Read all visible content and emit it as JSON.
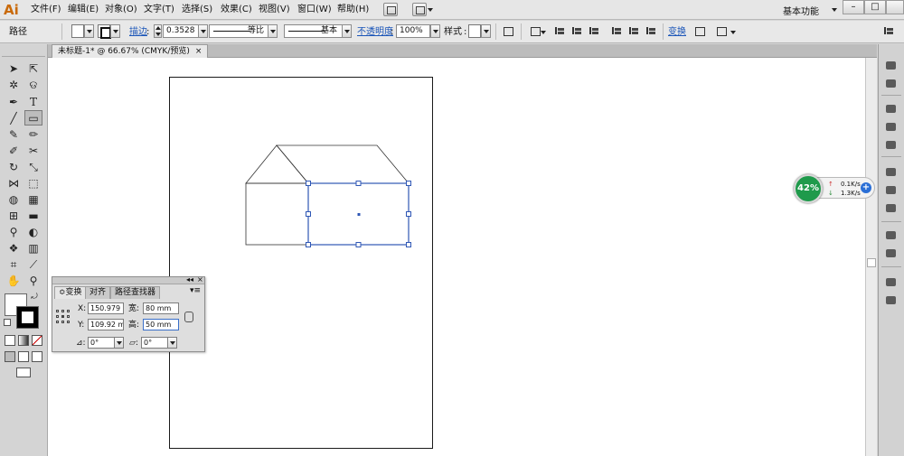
{
  "app": {
    "logo": "Ai"
  },
  "menu": {
    "items": [
      "文件(F)",
      "编辑(E)",
      "对象(O)",
      "文字(T)",
      "选择(S)",
      "效果(C)",
      "视图(V)",
      "窗口(W)",
      "帮助(H)"
    ],
    "workspace": "基本功能",
    "window_buttons": [
      "–",
      "□",
      "×"
    ]
  },
  "control_bar": {
    "object_type": "路径",
    "stroke_label": "描边",
    "stroke_weight": "0.3528",
    "profile": "等比",
    "brush": "基本",
    "opacity_label": "不透明度",
    "opacity": "100%",
    "style_label": "样式",
    "transform_label": "变换"
  },
  "document": {
    "tab_title": "未标题-1* @ 66.67% (CMYK/预览)",
    "tab_close": "×"
  },
  "transform_panel": {
    "tabs": [
      "变换",
      "对齐",
      "路径查找器"
    ],
    "tab_prefix": "≎",
    "menu": "▾≡",
    "collapse": "◂◂",
    "close": "×",
    "x_label": "X:",
    "x_value": "150.979",
    "y_label": "Y:",
    "y_value": "109.92 m",
    "w_label": "宽:",
    "w_value": "80 mm",
    "h_label": "高:",
    "h_value": "50 mm",
    "rotate_label": "⊿:",
    "rotate_value": "0°",
    "shear_label": "▱:",
    "shear_value": "0°"
  },
  "net_widget": {
    "percent": "42%",
    "upload": "0.1K/s",
    "download": "1.3K/s",
    "plus": "+",
    "color": "#1f9a4b"
  },
  "colors": {
    "selection": "#2f57b5",
    "ai_logo": "#c96a0a",
    "link": "#1a55b8"
  }
}
